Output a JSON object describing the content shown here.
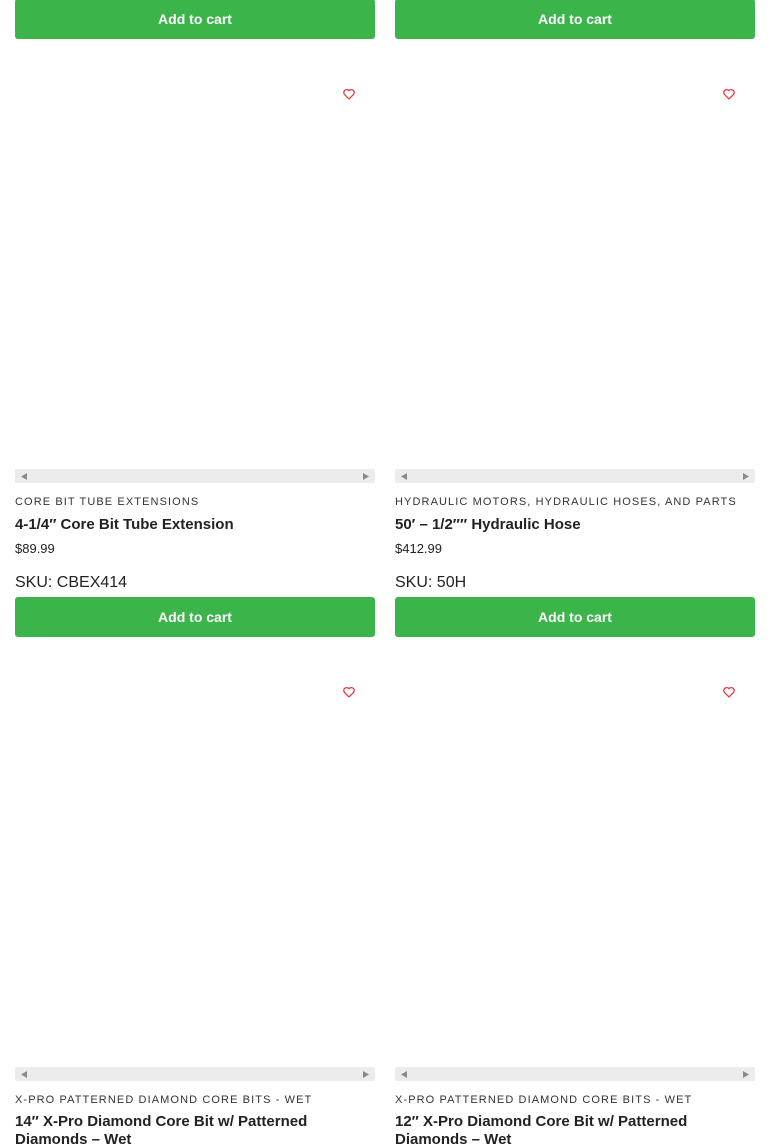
{
  "top_row": {
    "buttons": [
      "Add to cart",
      "Add to cart"
    ]
  },
  "products": [
    {
      "category": "CORE BIT TUBE EXTENSIONS",
      "title": "4-1/4″ Core Bit Tube Extension",
      "price": "$89.99",
      "sku": "SKU: CBEX414",
      "button": "Add to cart"
    },
    {
      "category": "HYDRAULIC MOTORS, HYDRAULIC HOSES, AND PARTS",
      "title": "50′ – 1/2″″ Hydraulic Hose",
      "price": "$412.99",
      "sku": "SKU: 50H",
      "button": "Add to cart"
    },
    {
      "category": "X-PRO PATTERNED DIAMOND CORE BITS - WET",
      "title": "14″ X-Pro Diamond Core Bit w/ Patterned Diamonds – Wet"
    },
    {
      "category": "X-PRO PATTERNED DIAMOND CORE BITS - WET",
      "title": "12″ X-Pro Diamond Core Bit w/ Patterned Diamonds – Wet"
    }
  ],
  "icons": {
    "wishlist": "heart-outline-icon",
    "scroll_left": "triangle-left-icon",
    "scroll_right": "triangle-right-icon"
  },
  "colors": {
    "accent": "#3bb44a",
    "wishlist": "#e0393e"
  }
}
